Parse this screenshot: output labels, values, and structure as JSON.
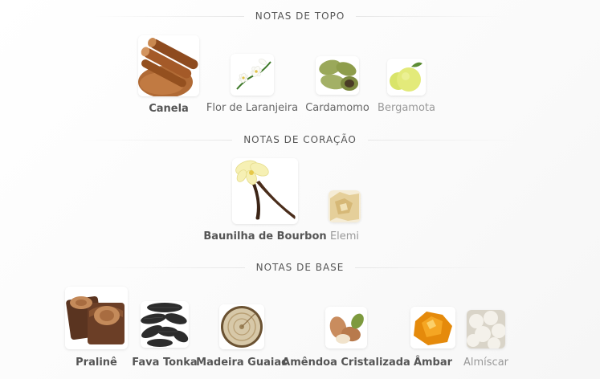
{
  "sections": {
    "top": {
      "title": "NOTAS DE TOPO",
      "notes": [
        {
          "label": "Canela",
          "icon": "cinnamon-icon"
        },
        {
          "label": "Flor de Laranjeira",
          "icon": "orange-blossom-icon"
        },
        {
          "label": "Cardamomo",
          "icon": "cardamom-icon"
        },
        {
          "label": "Bergamota",
          "icon": "bergamot-icon"
        }
      ]
    },
    "heart": {
      "title": "NOTAS DE CORAÇÃO",
      "notes": [
        {
          "label": "Baunilha de Bourbon",
          "icon": "vanilla-icon"
        },
        {
          "label": "Elemi",
          "icon": "elemi-resin-icon"
        }
      ]
    },
    "base": {
      "title": "NOTAS DE BASE",
      "notes": [
        {
          "label": "Pralinê",
          "icon": "praline-icon"
        },
        {
          "label": "Fava Tonka",
          "icon": "tonka-bean-icon"
        },
        {
          "label": "Madeira Guaiac",
          "icon": "guaiac-wood-icon"
        },
        {
          "label": "Amêndoa Cristalizada",
          "icon": "almond-icon"
        },
        {
          "label": "Âmbar",
          "icon": "amber-icon"
        },
        {
          "label": "Almíscar",
          "icon": "musk-icon"
        }
      ]
    }
  }
}
